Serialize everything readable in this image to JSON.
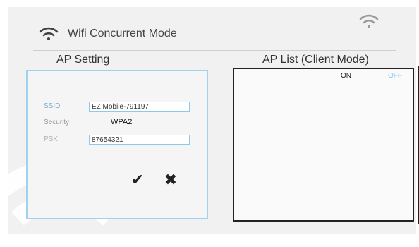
{
  "header": {
    "title": "Wifi Concurrent Mode"
  },
  "sections": {
    "ap_setting": "AP Setting",
    "ap_list": "AP List (Client Mode)"
  },
  "form": {
    "ssid_label": "SSID",
    "ssid_value": "EZ Mobile-791197",
    "security_label": "Security",
    "security_value": "WPA2",
    "psk_label": "PSK",
    "psk_value": "87654321"
  },
  "buttons": {
    "ok_symbol": "✔",
    "cancel_symbol": "✖"
  },
  "ap_list": {
    "on_label": "ON",
    "off_label": "OFF"
  },
  "colors": {
    "accent": "#8ccaec",
    "text": "#333333",
    "background": "#f1f1f1"
  },
  "icons": {
    "header": "wifi-icon",
    "status": "wifi-icon",
    "background": "wifi-watermark-icon"
  }
}
